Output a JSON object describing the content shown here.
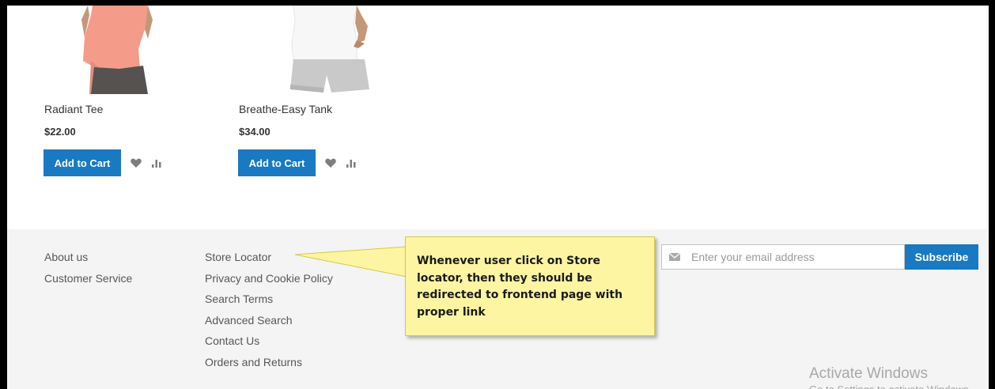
{
  "products": [
    {
      "name": "Radiant Tee",
      "price": "$22.00",
      "add_to_cart_label": "Add to Cart",
      "image_icon": "product-image-pink-tee"
    },
    {
      "name": "Breathe-Easy Tank",
      "price": "$34.00",
      "add_to_cart_label": "Add to Cart",
      "image_icon": "product-image-white-tank"
    }
  ],
  "footer": {
    "column1_links": [
      "About us",
      "Customer Service"
    ],
    "column2_links": [
      "Store Locator",
      "Privacy and Cookie Policy",
      "Search Terms",
      "Advanced Search",
      "Contact Us",
      "Orders and Returns"
    ],
    "newsletter": {
      "placeholder": "Enter your email address",
      "subscribe_label": "Subscribe"
    }
  },
  "annotation": {
    "text": "Whenever user click on Store locator, then they should be redirected to frontend page with proper link"
  },
  "watermark": {
    "title": "Activate Windows",
    "subtitle": "Go to Settings to activate Windows."
  },
  "colors": {
    "primary_button": "#1979c3",
    "footer_bg": "#f4f4f4",
    "callout_bg": "#fdf5a1",
    "frame_border": "#000000"
  }
}
